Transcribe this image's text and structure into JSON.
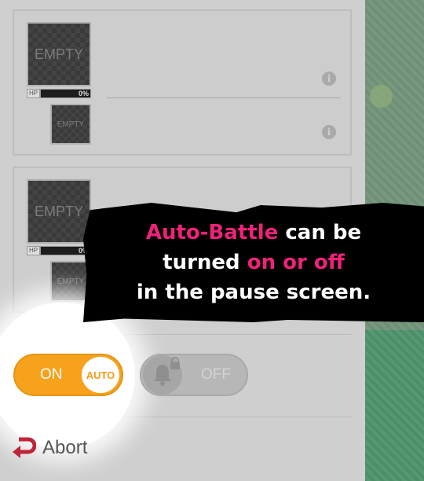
{
  "slots": {
    "empty_label": "EMPTY",
    "hp_label": "HP",
    "hp_value": "0%"
  },
  "info_glyph": "i",
  "banner": {
    "line1_highlight": "Auto-Battle",
    "line1_rest": " can be",
    "line2_start": "turned ",
    "line2_highlight": "on or off",
    "line3": "in the pause screen."
  },
  "auto_toggle": {
    "on_label": "ON",
    "knob_label": "AUTO",
    "state": "on"
  },
  "notify_toggle": {
    "off_label": "OFF",
    "state": "off"
  },
  "abort": {
    "label": "Abort"
  },
  "colors": {
    "accent_orange": "#f7a21c",
    "highlight_pink": "#f0217a"
  },
  "icons": [
    "info-icon",
    "bell-icon",
    "lock-icon",
    "return-arrow-icon"
  ]
}
